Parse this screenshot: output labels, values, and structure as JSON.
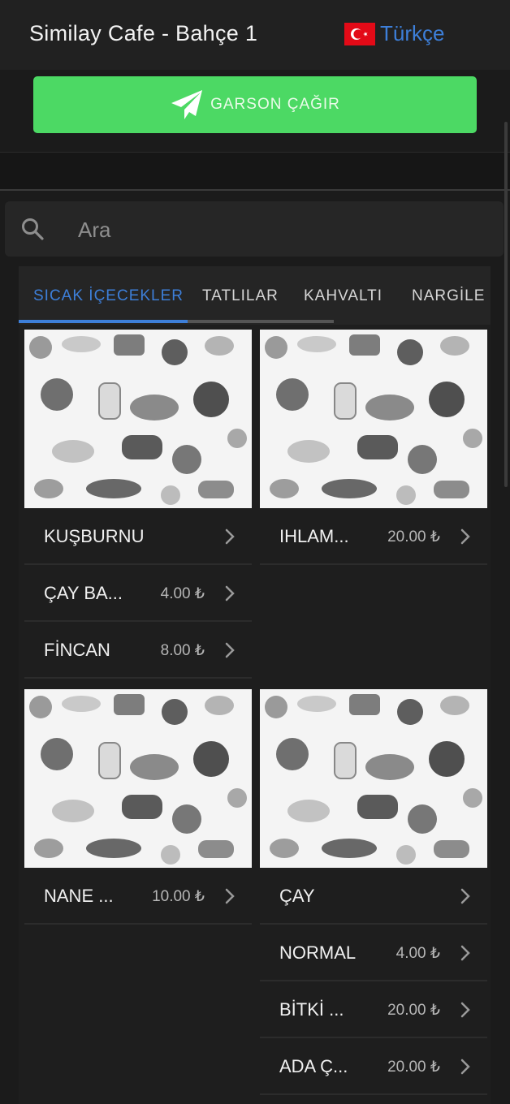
{
  "header": {
    "title": "Similay Cafe - Bahçe 1",
    "language": "Türkçe"
  },
  "call_waiter": {
    "label": "GARSON ÇAĞIR"
  },
  "search": {
    "placeholder": "Ara"
  },
  "tabs": [
    {
      "label": "SICAK İÇECEKLER",
      "active": true
    },
    {
      "label": "TATLILAR"
    },
    {
      "label": "KAHVALTI"
    },
    {
      "label": "NARGİLE"
    }
  ],
  "cards": [
    {
      "items": [
        {
          "name": "KUŞBURNU",
          "price": ""
        },
        {
          "name": "ÇAY BA...",
          "price": "4.00 ₺"
        },
        {
          "name": "FİNCAN",
          "price": "8.00 ₺"
        }
      ]
    },
    {
      "items": [
        {
          "name": "IHLAM...",
          "price": "20.00 ₺"
        }
      ]
    },
    {
      "items": [
        {
          "name": "NANE ...",
          "price": "10.00 ₺"
        }
      ]
    },
    {
      "items": [
        {
          "name": "ÇAY",
          "price": ""
        },
        {
          "name": "NORMAL",
          "price": "4.00 ₺"
        },
        {
          "name": "BİTKİ ...",
          "price": "20.00 ₺"
        },
        {
          "name": "ADA Ç...",
          "price": "20.00 ₺"
        }
      ]
    }
  ],
  "colors": {
    "accent": "#3d7fd9",
    "call_button": "#4cd964",
    "background": "#1b1b1b",
    "flag_red": "#e30a17"
  },
  "icons": {
    "flag": "turkey-flag-icon",
    "call": "paper-plane-icon",
    "search": "search-icon",
    "item": "chevron-right-icon"
  }
}
